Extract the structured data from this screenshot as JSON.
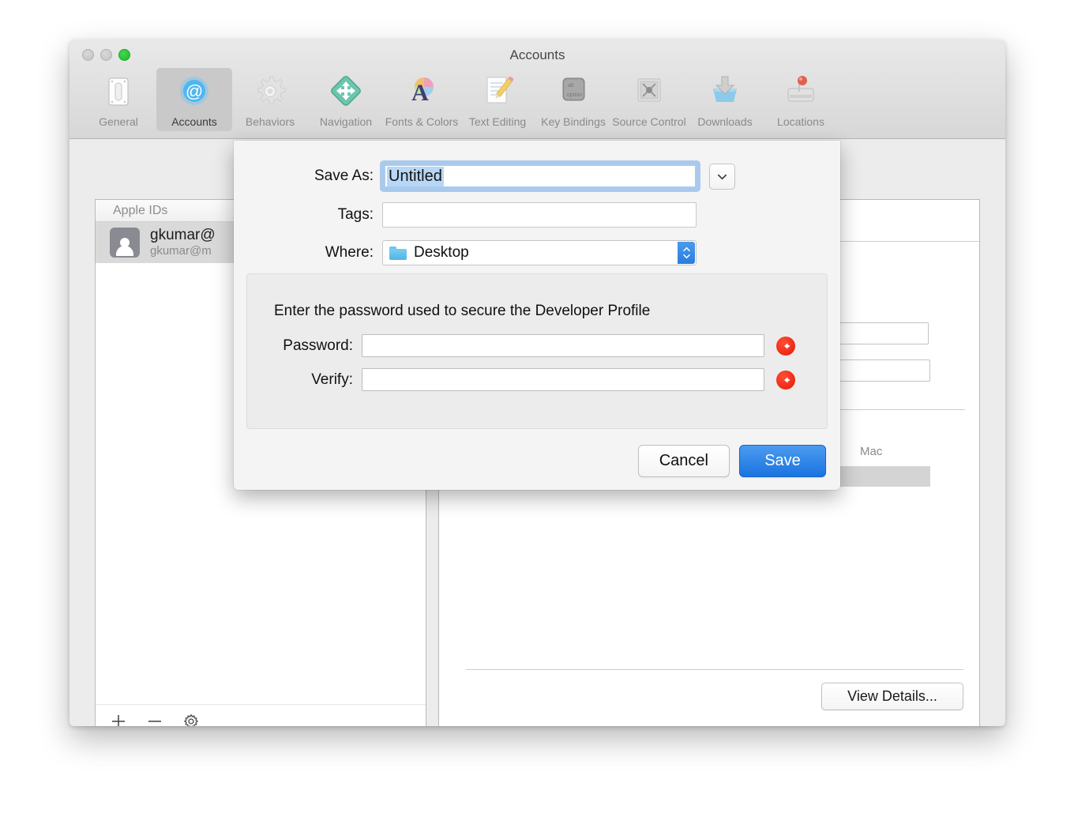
{
  "window": {
    "title": "Accounts",
    "traffic_lights": [
      "close-button",
      "minimize-button",
      "zoom-button"
    ]
  },
  "toolbar": {
    "items": [
      {
        "label": "General",
        "icon": "switch-icon",
        "selected": false
      },
      {
        "label": "Accounts",
        "icon": "at-sign-icon",
        "selected": true
      },
      {
        "label": "Behaviors",
        "icon": "gear-icon",
        "selected": false
      },
      {
        "label": "Navigation",
        "icon": "compass-arrows-icon",
        "selected": false
      },
      {
        "label": "Fonts & Colors",
        "icon": "font-palette-icon",
        "selected": false
      },
      {
        "label": "Text Editing",
        "icon": "pencil-page-icon",
        "selected": false
      },
      {
        "label": "Key Bindings",
        "icon": "keyboard-key-icon",
        "selected": false
      },
      {
        "label": "Source Control",
        "icon": "safe-vault-icon",
        "selected": false
      },
      {
        "label": "Downloads",
        "icon": "download-tray-icon",
        "selected": false
      },
      {
        "label": "Locations",
        "icon": "hard-drive-pin-icon",
        "selected": false
      }
    ],
    "key_binding_icon_top": "alt",
    "key_binding_icon_bottom": "option"
  },
  "sidebar": {
    "header": "Apple IDs",
    "rows": [
      {
        "title": "gkumar@",
        "subtitle": "gkumar@m"
      }
    ],
    "footer_buttons": [
      {
        "name": "add-account-button",
        "glyph": "+"
      },
      {
        "name": "remove-account-button",
        "glyph": "−"
      },
      {
        "name": "account-options-button",
        "glyph": "gear"
      }
    ]
  },
  "detail": {
    "column_header": "Mac",
    "view_details_label": "View Details..."
  },
  "sheet": {
    "save_as": {
      "label": "Save As:",
      "value": "Untitled",
      "expand_icon": "chevron-down-icon"
    },
    "tags": {
      "label": "Tags:",
      "value": "",
      "placeholder": ""
    },
    "where": {
      "label": "Where:",
      "value": "Desktop",
      "icon": "folder-icon",
      "stepper_icon": "up-down-chevrons-icon"
    },
    "password_panel": {
      "description": "Enter the password used to secure the Developer Profile",
      "password": {
        "label": "Password:",
        "value": "",
        "warning_icon": "red-left-arrow-icon"
      },
      "verify": {
        "label": "Verify:",
        "value": "",
        "warning_icon": "red-left-arrow-icon"
      }
    },
    "buttons": {
      "cancel": "Cancel",
      "save": "Save"
    }
  },
  "colors": {
    "accent_blue": "#1a73e0",
    "focus_ring": "#a9cbef",
    "selection": "#b8d6f5",
    "warning_red": "#e3190a",
    "window_chrome": "#ececec",
    "sheet_bg": "#f4f4f4"
  }
}
